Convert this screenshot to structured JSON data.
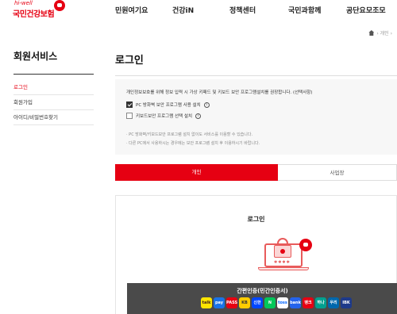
{
  "header": {
    "logo_tag": "hi-well",
    "logo_name": "국민건강보험",
    "menu": [
      "민원여기요",
      "건강iN",
      "정책센터",
      "국민과함께",
      "공단요모조모"
    ]
  },
  "breadcrumb": {
    "trail": "› 개인 ›"
  },
  "sidebar": {
    "title": "회원서비스",
    "items": [
      "로그인",
      "회원가입",
      "아이디/비밀번호찾기"
    ]
  },
  "main": {
    "title": "로그인",
    "notice": "개인정보보호를 위해 정보 입력 시 가상 키패드 및 키보드 보안 프로그램설치를 권장합니다. (선택사항)",
    "options": [
      {
        "label": "PC 방화벽 보안 프로그램 사용 설치",
        "checked": true
      },
      {
        "label": "키보드보안 프로그램 선택 설치",
        "checked": false
      }
    ],
    "bullets": [
      "· PC 방화벽/키보드보안 프로그램 설치 없이도 서비스를 이용할 수 있습니다.",
      "· 다른 PC에서 사용하시는 경우에는 보안 프로그램 설치 후 이용하시기 바랍니다."
    ],
    "tabs": [
      "개인",
      "사업장"
    ],
    "card": {
      "title": "로그인",
      "password_dots": "✱✱✱✱",
      "cert_title": "간편인증(민간인증서)",
      "cert_providers": [
        {
          "label": "talk",
          "bg": "#fee500",
          "fg": "#3c1e1e"
        },
        {
          "label": "pay",
          "bg": "#1a73e8",
          "fg": "#ffffff"
        },
        {
          "label": "PASS",
          "bg": "#e60012",
          "fg": "#ffffff"
        },
        {
          "label": "KB",
          "bg": "#ffcc00",
          "fg": "#333333"
        },
        {
          "label": "신한",
          "bg": "#0046ff",
          "fg": "#ffffff"
        },
        {
          "label": "N",
          "bg": "#03c75a",
          "fg": "#ffffff"
        },
        {
          "label": "toss",
          "bg": "#ffffff",
          "fg": "#0064ff"
        },
        {
          "label": "bank",
          "bg": "#2563eb",
          "fg": "#ffffff"
        },
        {
          "label": "뱅크",
          "bg": "#e60012",
          "fg": "#ffffff"
        },
        {
          "label": "하나",
          "bg": "#00a08f",
          "fg": "#ffffff"
        },
        {
          "label": "우리",
          "bg": "#0067ac",
          "fg": "#ffffff"
        },
        {
          "label": "IBK",
          "bg": "#1e3a8a",
          "fg": "#ffffff"
        }
      ]
    }
  }
}
